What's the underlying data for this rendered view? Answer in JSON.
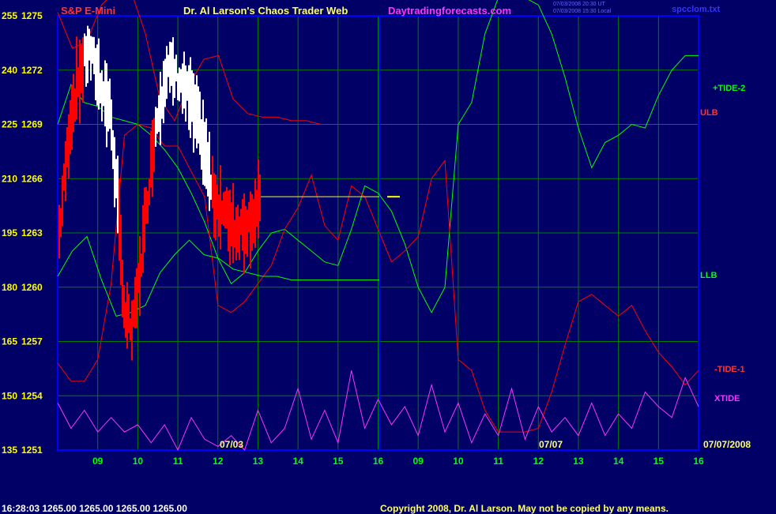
{
  "header": {
    "instrument": "S&P E-Mini",
    "title": "Dr. Al Larson's Chaos Trader Web",
    "site": "Daytradingforecasts.com",
    "time_line1": "07/03/2008 20:30 UT",
    "time_line2": "07/03/2008 15:30 Local",
    "filename": "spcclom.txt"
  },
  "footer": {
    "quote": "16:28:03  1265.00  1265.00  1265.00  1265.00",
    "copyright": "Copyright 2008, Dr. Al Larson. May not be copied by any means."
  },
  "labels": {
    "tide2": "+TIDE-2",
    "ulb": "ULB",
    "llb": "LLB",
    "tide1": "-TIDE-1",
    "xtide": "XTIDE",
    "date1": "07/03",
    "date2": "07/07",
    "date_right": "07/07/2008"
  },
  "colors": {
    "background": "#000066",
    "grid": "#008000",
    "price": "#ff0000",
    "white_price": "#ffffff",
    "tide2": "#00ff00",
    "tide1": "#ff0000",
    "xtide": "#ff33ff",
    "yellow": "#ffff00",
    "blue": "#0000ff"
  },
  "chart_data": {
    "type": "line",
    "title": "S&P E-Mini",
    "y_left_ticks": [
      "255",
      "240",
      "225",
      "210",
      "195",
      "180",
      "165",
      "150",
      "135"
    ],
    "y_right_ticks": [
      "1275",
      "1272",
      "1269",
      "1266",
      "1263",
      "1260",
      "1257",
      "1254",
      "1251"
    ],
    "x_ticks": [
      "09",
      "10",
      "11",
      "12",
      "13",
      "14",
      "15",
      "16",
      "09",
      "10",
      "11",
      "12",
      "13",
      "14",
      "15",
      "16"
    ],
    "series": [
      {
        "name": "+TIDE-2",
        "values": [
          225,
          236,
          231,
          230,
          227,
          226,
          225,
          222,
          218,
          213,
          206,
          198,
          188,
          181,
          184,
          190,
          195,
          196,
          193,
          190,
          187,
          186,
          196,
          208,
          206,
          201,
          192,
          180,
          173,
          180,
          225,
          231,
          250,
          260,
          260,
          260,
          258,
          250,
          238,
          224,
          213,
          220,
          222,
          225,
          224,
          233,
          240,
          244,
          244
        ]
      },
      {
        "name": "-TIDE-1",
        "values": [
          159,
          154,
          154,
          160,
          181,
          222,
          225,
          224,
          219,
          219,
          212,
          205,
          175,
          173,
          176,
          181,
          186,
          196,
          202,
          211,
          197,
          193,
          208,
          205,
          196,
          187,
          190,
          194,
          210,
          215,
          160,
          157,
          146,
          140,
          140,
          140,
          141,
          151,
          164,
          176,
          178,
          175,
          172,
          175,
          168,
          162,
          158,
          153,
          157
        ]
      },
      {
        "name": "XTIDE",
        "values": [
          148,
          141,
          146,
          140,
          144,
          140,
          142,
          137,
          142,
          135,
          144,
          138,
          136,
          139,
          135,
          146,
          137,
          141,
          152,
          138,
          146,
          137,
          157,
          141,
          149,
          142,
          147,
          139,
          153,
          140,
          148,
          137,
          145,
          139,
          152,
          138,
          147,
          140,
          144,
          139,
          148,
          139,
          145,
          141,
          151,
          147,
          144,
          155,
          147
        ]
      },
      {
        "name": "ULB",
        "values": [
          256,
          246,
          248,
          258,
          262,
          262,
          250,
          232,
          226,
          236,
          243,
          244,
          232,
          228,
          227,
          227,
          226,
          226,
          225,
          225,
          225,
          225,
          225
        ]
      },
      {
        "name": "LLB",
        "values": [
          183,
          190,
          194,
          182,
          172,
          173,
          175,
          184,
          189,
          193,
          189,
          188,
          185,
          184,
          183,
          183,
          182,
          182,
          182,
          182,
          182,
          182,
          182
        ]
      }
    ]
  }
}
